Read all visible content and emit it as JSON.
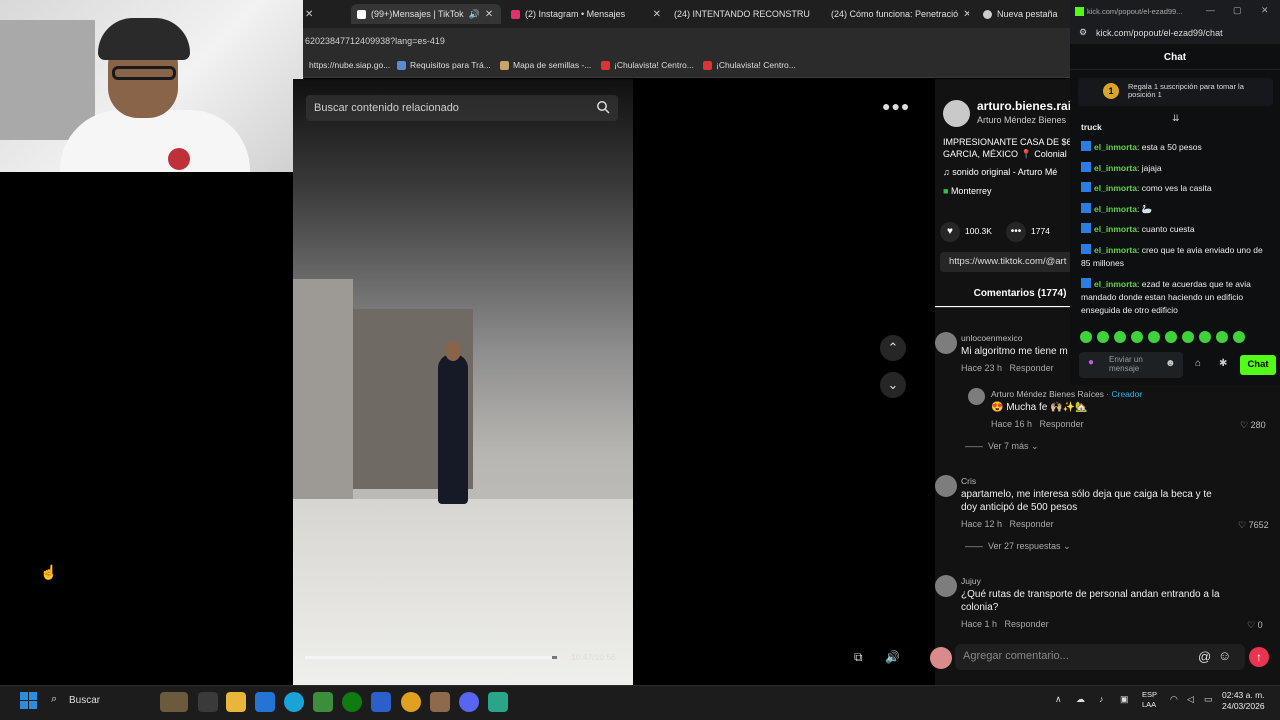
{
  "browser": {
    "tabs": [
      {
        "label": "(99+)Mensajes | TikTok",
        "color": "#ffffff"
      },
      {
        "label": "(2) Instagram • Mensajes",
        "color": "#e1306c"
      },
      {
        "label": "(24) INTENTANDO RECONSTRU",
        "color": "#ff0000"
      },
      {
        "label": "(24) Cómo funciona: Penetració",
        "color": "#ff0000"
      },
      {
        "label": "Nueva pestaña",
        "color": "#cccccc"
      }
    ],
    "url": "62023847712409938?lang=es-419",
    "bookmarks": [
      "https://nube.siap.go...",
      "Requisitos para Trá...",
      "Mapa de semillas -...",
      "¡Chulavista! Centro...",
      "¡Chulavista! Centro..."
    ]
  },
  "video": {
    "search_placeholder": "Buscar contenido relacionado",
    "time": "10:47/10:56",
    "progress": 0.98
  },
  "post": {
    "username": "arturo.bienes.rai",
    "display_name": "Arturo Méndez Bienes",
    "caption_line1": "IMPRESIONANTE CASA DE $6",
    "caption_line2": "GARCIA, MÉXICO 📍 Colonial",
    "sound": "sonido original - Arturo Mé",
    "location": "Monterrey",
    "likes": "100.3K",
    "comments_count": "1774",
    "link": "https://www.tiktok.com/@art",
    "comments_tab": "Comentarios (1774)"
  },
  "comments": [
    {
      "user": "unlocoenmexico",
      "text": "Mi algoritmo me tiene m",
      "time": "Hace 23 h",
      "reply": "Responder",
      "likes": ""
    },
    {
      "user": "Arturo Méndez Bienes Raíces",
      "creator_tag": "· Creador",
      "text": "😍 Mucha fe 🙌🏼✨🏡",
      "time": "Hace 16 h",
      "reply": "Responder",
      "likes": "280"
    },
    {
      "user": "Cris",
      "text": "apartamelo, me interesa sólo deja que caiga la beca y te doy anticipó de 500 pesos",
      "time": "Hace 12 h",
      "reply": "Responder",
      "likes": "7652"
    },
    {
      "user": "Jujuy",
      "text": "¿Qué rutas de transporte de personal andan entrando a la colonia?",
      "time": "Hace 1 h",
      "reply": "Responder",
      "likes": "0"
    }
  ],
  "more_replies": [
    "Ver 7 más",
    "Ver 27 respuestas"
  ],
  "comment_placeholder": "Agregar comentario...",
  "kick": {
    "url": "kick.com/popout/el-ezad99/chat",
    "title_url": "kick.com/popout/el-ezad99...",
    "header": "Chat",
    "gift_banner": "Regala 1 suscripción para tomar la posición 1",
    "gift_rank": "1",
    "messages": [
      {
        "user": "",
        "text": "truck"
      },
      {
        "user": "el_inmorta",
        "text": ": esta a 50 pesos"
      },
      {
        "user": "el_inmorta",
        "text": ": jajaja"
      },
      {
        "user": "el_inmorta",
        "text": ": como ves la casita"
      },
      {
        "user": "el_inmorta",
        "text": ": 🦢"
      },
      {
        "user": "el_inmorta",
        "text": ": cuanto cuesta"
      },
      {
        "user": "el_inmorta",
        "text": ": creo que te avia enviado uno de 85 millones"
      },
      {
        "user": "el_inmorta",
        "text": ": ezad te acuerdas que te avia mandado donde estan haciendo un edificio enseguida de otro edificio"
      }
    ],
    "input_placeholder": "Enviar un mensaje",
    "chat_button": "Chat"
  },
  "taskbar": {
    "search": "Buscar",
    "lang": "ESP",
    "lang2": "LAA",
    "time": "02:43 a. m.",
    "date": "24/03/2026"
  },
  "colors": {
    "tiktok_red": "#e8344f",
    "kick_green": "#53fc18"
  }
}
